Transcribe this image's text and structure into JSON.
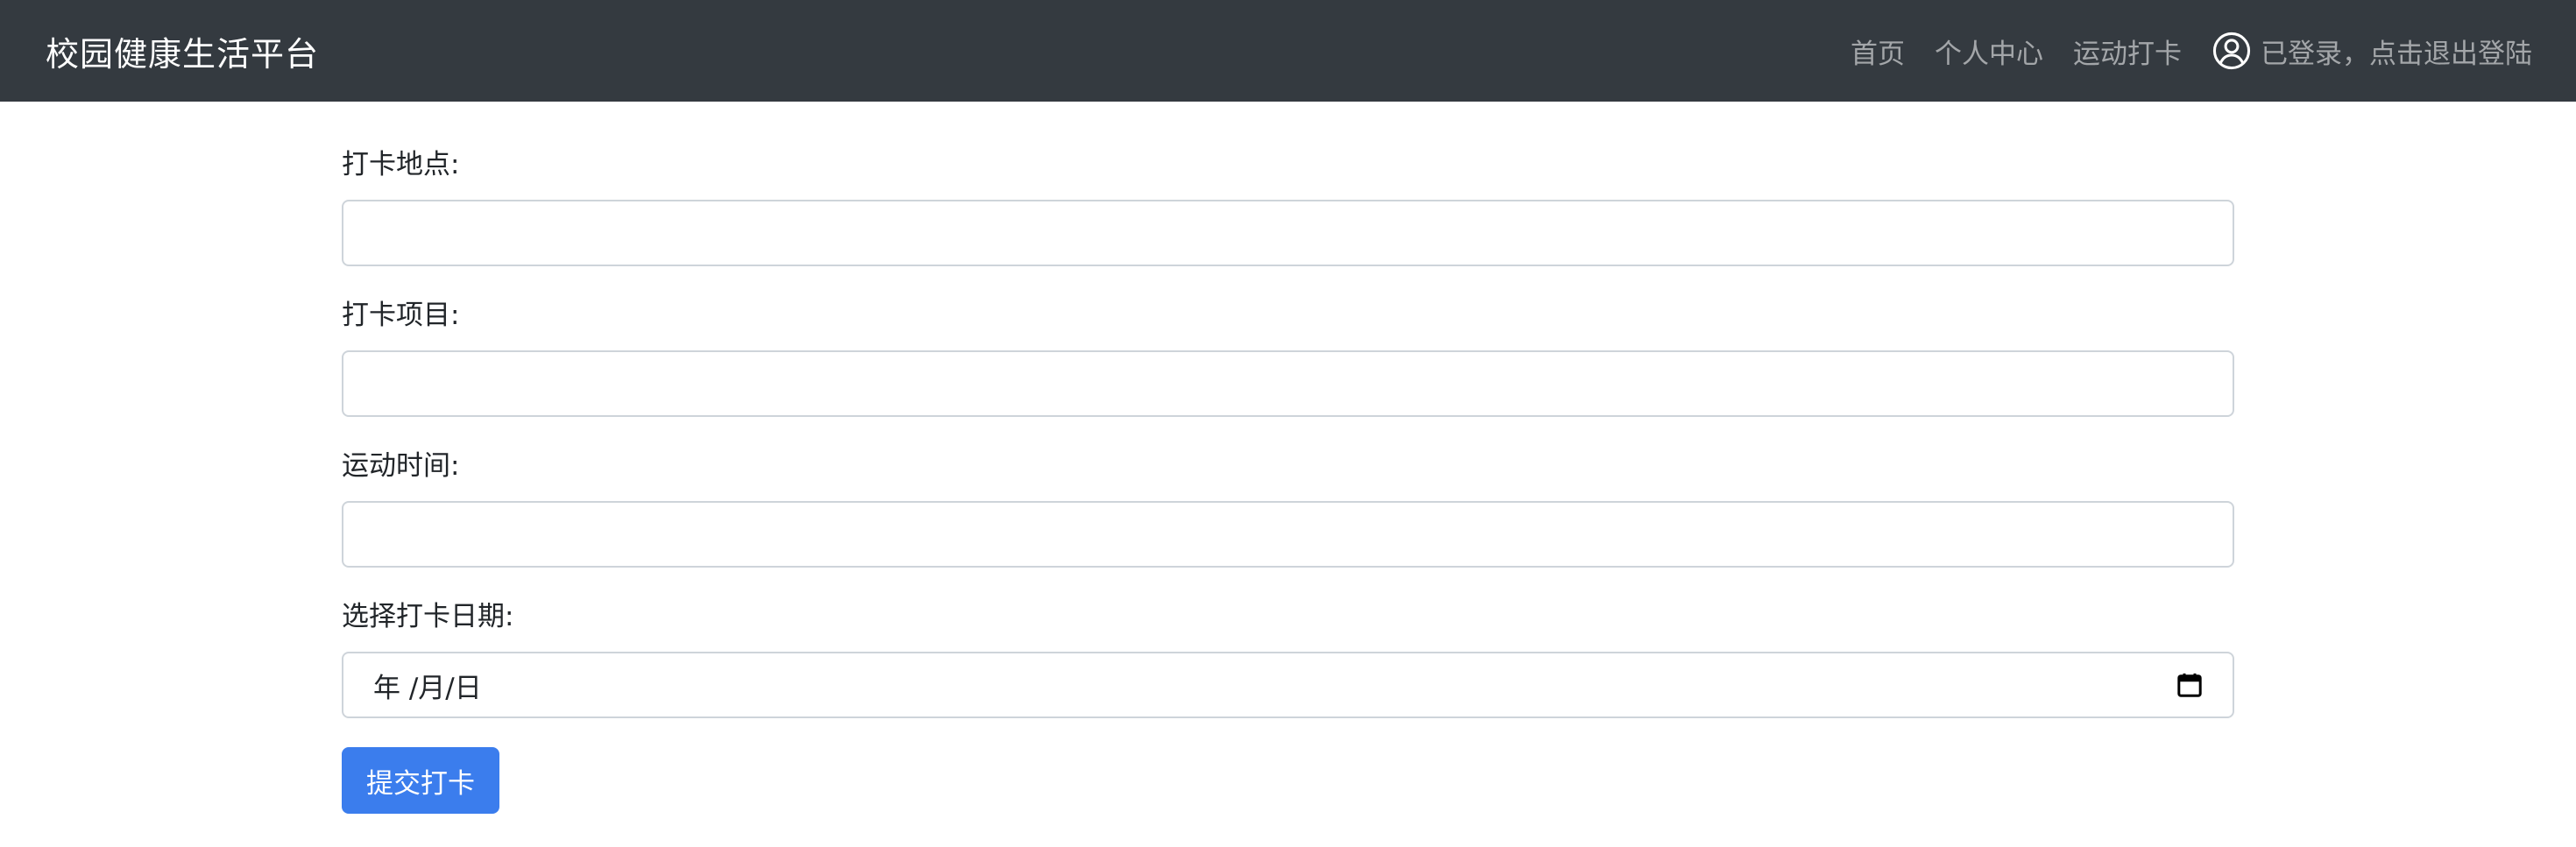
{
  "navbar": {
    "brand": "校园健康生活平台",
    "links": [
      {
        "label": "首页"
      },
      {
        "label": "个人中心"
      },
      {
        "label": "运动打卡"
      }
    ],
    "user_status": "已登录，点击退出登陆",
    "user_icon": "user-circle-icon"
  },
  "form": {
    "location_label": "打卡地点:",
    "location_value": "",
    "item_label": "打卡项目:",
    "item_value": "",
    "time_label": "运动时间:",
    "time_value": "",
    "date_label": "选择打卡日期:",
    "date_placeholder": "年 /月/日",
    "date_icon": "calendar-icon",
    "submit_label": "提交打卡"
  },
  "colors": {
    "navbar_bg": "#343a40",
    "primary": "#3b7ded"
  }
}
